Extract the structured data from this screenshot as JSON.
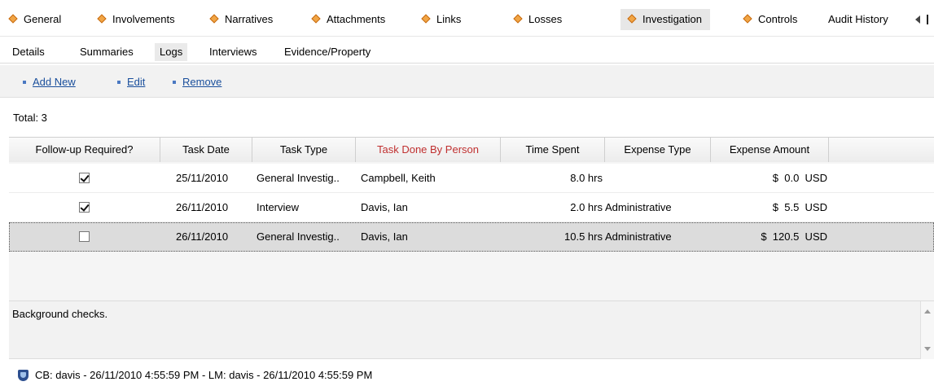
{
  "top_tabs": [
    {
      "label": "General",
      "icon": "diamond-icon"
    },
    {
      "label": "Involvements",
      "icon": "diamond-icon"
    },
    {
      "label": "Narratives",
      "icon": "diamond-icon"
    },
    {
      "label": "Attachments",
      "icon": "diamond-icon"
    },
    {
      "label": "Links",
      "icon": "diamond-icon"
    },
    {
      "label": "Losses",
      "icon": "diamond-icon"
    },
    {
      "label": "Investigation",
      "icon": "diamond-icon",
      "active": true
    },
    {
      "label": "Controls",
      "icon": "diamond-icon"
    },
    {
      "label": "Audit History"
    }
  ],
  "sub_tabs": [
    {
      "label": "Details"
    },
    {
      "label": "Summaries"
    },
    {
      "label": "Logs",
      "active": true
    },
    {
      "label": "Interviews"
    },
    {
      "label": "Evidence/Property"
    }
  ],
  "actions": {
    "add_new": "Add New",
    "edit": "Edit",
    "remove": "Remove"
  },
  "total_label": "Total: 3",
  "grid": {
    "columns": [
      "Follow-up Required?",
      "Task Date",
      "Task Type",
      "Task Done By Person",
      "Time Spent",
      "Expense Type",
      "Expense Amount"
    ],
    "rows": [
      {
        "followup": true,
        "date": "25/11/2010",
        "type": "General Investig..",
        "person": "Campbell, Keith",
        "time": "8.0 hrs",
        "expense_type": "",
        "amount": "$  0.0  USD"
      },
      {
        "followup": true,
        "date": "26/11/2010",
        "type": "Interview",
        "person": "Davis, Ian",
        "time": "2.0 hrs",
        "expense_type": "Administrative",
        "amount": "$  5.5  USD"
      },
      {
        "followup": false,
        "date": "26/11/2010",
        "type": "General Investig..",
        "person": "Davis, Ian",
        "time": "10.5 hrs",
        "expense_type": "Administrative",
        "amount": "$  120.5  USD",
        "selected": true
      }
    ]
  },
  "notes_text": "Background checks.",
  "footer_text": "CB: davis - 26/11/2010 4:55:59 PM - LM: davis - 26/11/2010 4:55:59 PM",
  "colors": {
    "diamond": "#f1a545",
    "link": "#1a4f9c",
    "highlight_header": "#c03030"
  }
}
